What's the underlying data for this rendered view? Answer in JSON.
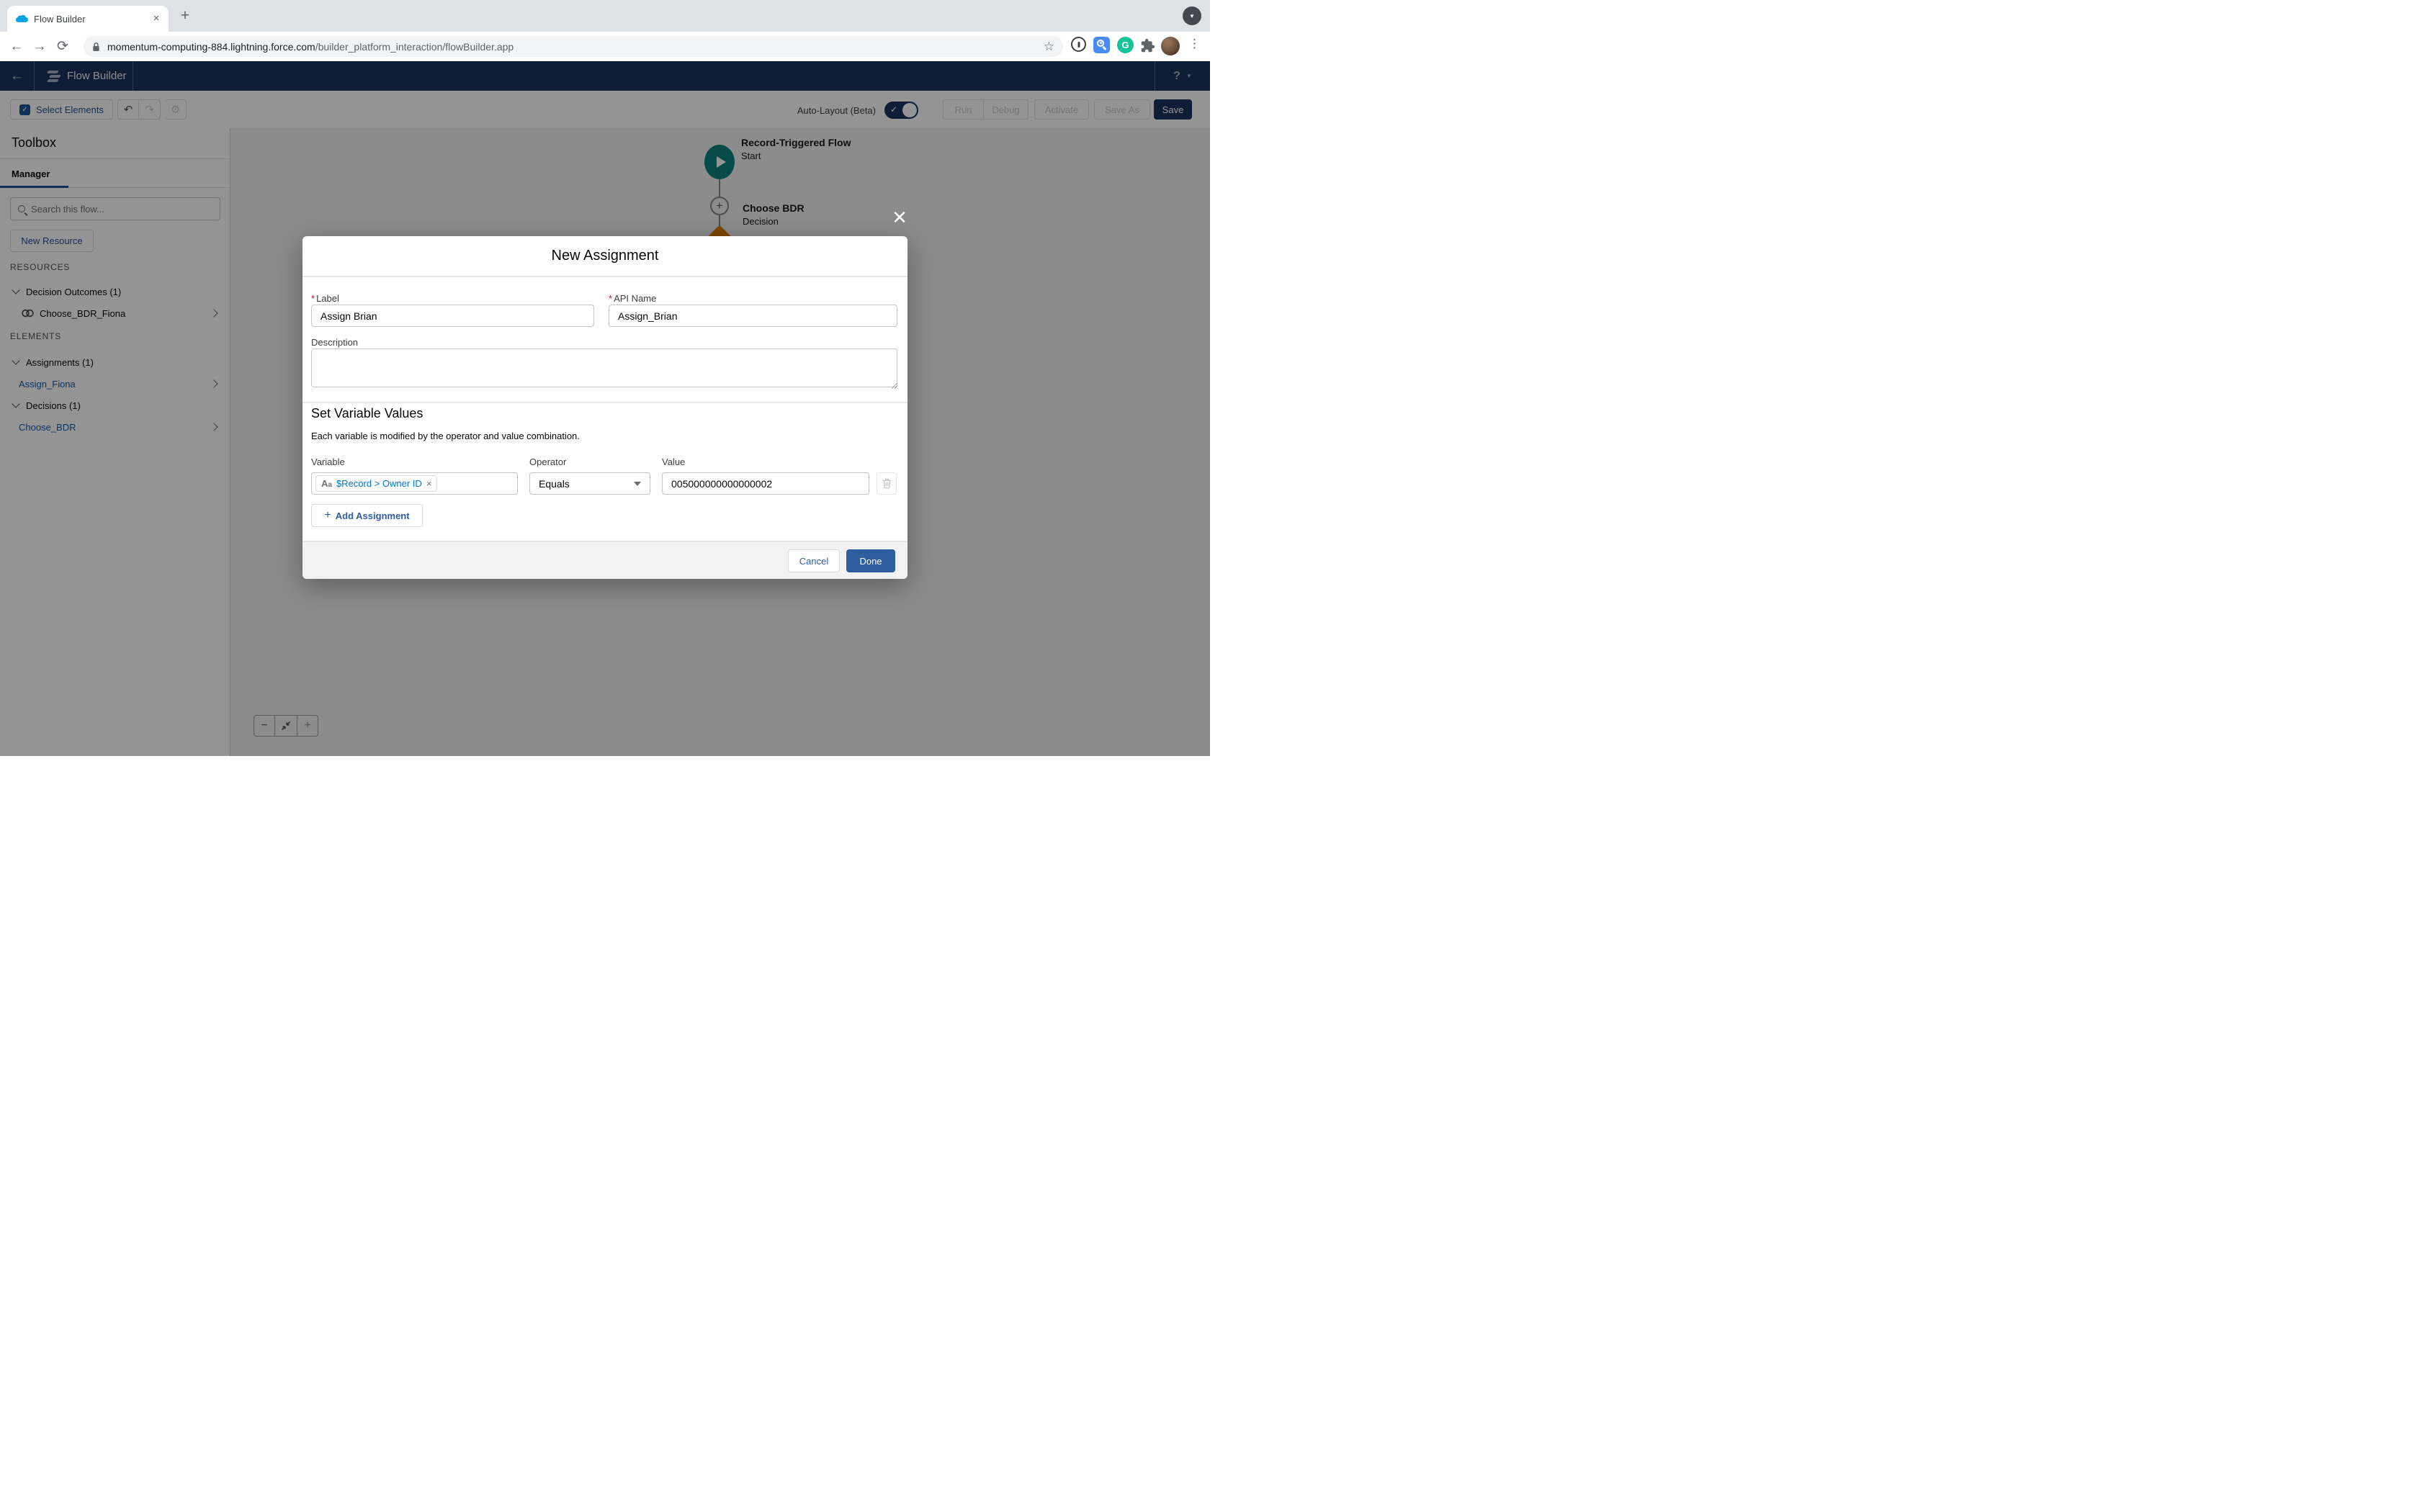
{
  "colors": {
    "header_navy": "#16325c",
    "brand_blue": "#0b5cab",
    "done_blue": "#2f5d9f",
    "start_teal": "#0b827c",
    "decision_orange": "#dd7a01",
    "required_red": "#ea001e",
    "grammarly_green": "#15c39a",
    "extension_blue": "#4a8cf7",
    "salesforce_cloud_blue": "#00a1e0"
  },
  "icons": {
    "tab_close": "×",
    "new_tab": "+",
    "tab_search_caret": "▼",
    "back": "←",
    "forward": "→",
    "reload": "⟳",
    "star": "☆",
    "overflow_menu": "⋮",
    "grammarly_letter": "G",
    "header_back": "←",
    "help": "?",
    "help_caret": "▼",
    "undo": "↶",
    "redo": "↷",
    "gear": "⚙",
    "plus_connector": "+",
    "zoom_out": "−",
    "zoom_in": "+",
    "add_plus": "+",
    "required": "*",
    "pill_remove": "×",
    "letter_A": "A",
    "letter_a": "a",
    "modal_close": "✕"
  },
  "browser": {
    "tab_title": "Flow Builder",
    "url_domain": "momentum-computing-884.lightning.force.com",
    "url_path": "/builder_platform_interaction/flowBuilder.app"
  },
  "header": {
    "app_name": "Flow Builder"
  },
  "toolbar": {
    "select_elements": "Select Elements",
    "auto_layout_label": "Auto-Layout (Beta)",
    "run": "Run",
    "debug": "Debug",
    "activate": "Activate",
    "save_as": "Save As",
    "save": "Save"
  },
  "sidebar": {
    "title": "Toolbox",
    "active_tab": "Manager",
    "search_placeholder": "Search this flow...",
    "new_resource_label": "New Resource",
    "resources_heading": "RESOURCES",
    "elements_heading": "ELEMENTS",
    "resources": {
      "group_label": "Decision Outcomes (1)",
      "item_label": "Choose_BDR_Fiona"
    },
    "elements": {
      "assignments_group": "Assignments (1)",
      "assignments_item": "Assign_Fiona",
      "decisions_group": "Decisions (1)",
      "decisions_item": "Choose_BDR"
    }
  },
  "canvas": {
    "start_title": "Record-Triggered Flow",
    "start_subtitle": "Start",
    "decision_title": "Choose BDR",
    "decision_subtitle": "Decision"
  },
  "modal": {
    "title": "New Assignment",
    "label_field": {
      "label": "Label",
      "value": "Assign Brian"
    },
    "api_field": {
      "label": "API Name",
      "value": "Assign_Brian"
    },
    "description_label": "Description",
    "section_title": "Set Variable Values",
    "section_subtitle": "Each variable is modified by the operator and value combination.",
    "row": {
      "variable_label": "Variable",
      "operator_label": "Operator",
      "value_label": "Value",
      "variable_pill": "$Record > Owner ID",
      "operator_value": "Equals",
      "value_value": "005000000000000002"
    },
    "add_assignment": "Add Assignment",
    "cancel": "Cancel",
    "done": "Done"
  }
}
